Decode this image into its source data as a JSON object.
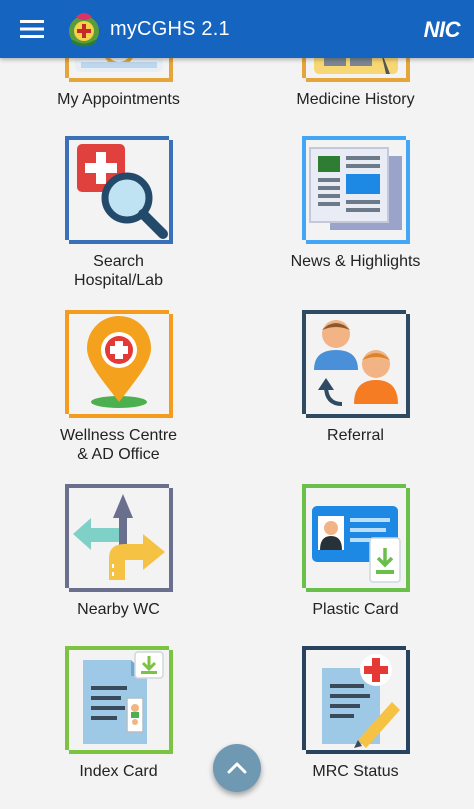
{
  "app": {
    "title": "myCGHS 2.1",
    "brand": "NIC"
  },
  "colors": {
    "appbar": "#1565c0",
    "background": "#f3f3f3",
    "fab": "#6f98b3"
  },
  "icons": {
    "menu": "hamburger-menu-icon",
    "scroll_top": "chevron-up-icon"
  },
  "tiles": [
    {
      "label": "My Appointments"
    },
    {
      "label": "Medicine History"
    },
    {
      "label": "Search\nHospital/Lab"
    },
    {
      "label": "News & Highlights"
    },
    {
      "label": "Wellness Centre\n& AD Office"
    },
    {
      "label": "Referral"
    },
    {
      "label": "Nearby WC"
    },
    {
      "label": "Plastic Card"
    },
    {
      "label": "Index Card"
    },
    {
      "label": "MRC Status"
    }
  ]
}
